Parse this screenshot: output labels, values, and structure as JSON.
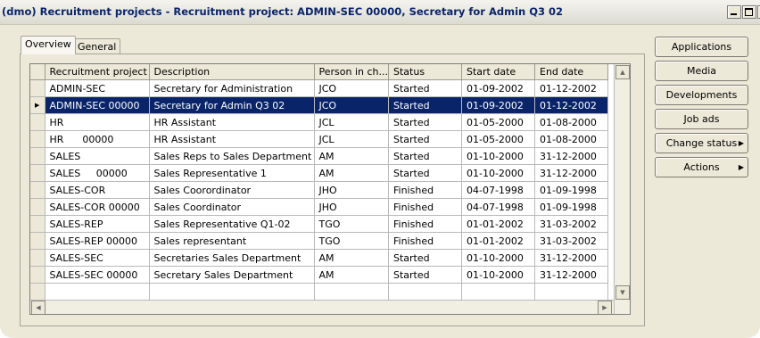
{
  "window": {
    "title": "(dmo) Recruitment projects - Recruitment project: ADMIN-SEC 00000, Secretary for Admin Q3 02"
  },
  "tabs": [
    {
      "label": "Overview",
      "active": true
    },
    {
      "label": "General",
      "active": false
    }
  ],
  "grid": {
    "columns": [
      "Recruitment project",
      "Description",
      "Person in ch...",
      "Status",
      "Start date",
      "End date"
    ],
    "selected_row": 1,
    "rows": [
      [
        "ADMIN-SEC",
        "Secretary for Administration",
        "JCO",
        "Started",
        "01-09-2002",
        "01-12-2002"
      ],
      [
        "ADMIN-SEC 00000",
        "Secretary for Admin Q3 02",
        "JCO",
        "Started",
        "01-09-2002",
        "01-12-2002"
      ],
      [
        "HR",
        "HR Assistant",
        "JCL",
        "Started",
        "01-05-2000",
        "01-08-2000"
      ],
      [
        "HR      00000",
        "HR Assistant",
        "JCL",
        "Started",
        "01-05-2000",
        "01-08-2000"
      ],
      [
        "SALES",
        "Sales Reps to Sales Department",
        "AM",
        "Started",
        "01-10-2000",
        "31-12-2000"
      ],
      [
        "SALES     00000",
        "Sales Representative 1",
        "AM",
        "Started",
        "01-10-2000",
        "31-12-2000"
      ],
      [
        "SALES-COR",
        "Sales Coorordinator",
        "JHO",
        "Finished",
        "04-07-1998",
        "01-09-1998"
      ],
      [
        "SALES-COR 00000",
        "Sales Coordinator",
        "JHO",
        "Finished",
        "04-07-1998",
        "01-09-1998"
      ],
      [
        "SALES-REP",
        "Sales Representative Q1-02",
        "TGO",
        "Finished",
        "01-01-2002",
        "31-03-2002"
      ],
      [
        "SALES-REP 00000",
        "Sales representant",
        "TGO",
        "Finished",
        "01-01-2002",
        "31-03-2002"
      ],
      [
        "SALES-SEC",
        "Secretaries Sales Department",
        "AM",
        "Started",
        "01-10-2000",
        "31-12-2000"
      ],
      [
        "SALES-SEC 00000",
        "Secretary Sales Department",
        "AM",
        "Started",
        "01-10-2000",
        "31-12-2000"
      ]
    ]
  },
  "side_buttons": [
    {
      "label": "Applications",
      "has_arrow": false
    },
    {
      "label": "Media",
      "has_arrow": false
    },
    {
      "label": "Developments",
      "has_arrow": false
    },
    {
      "label": "Job ads",
      "has_arrow": false
    },
    {
      "label": "Change status",
      "has_arrow": true
    },
    {
      "label": "Actions",
      "has_arrow": true
    }
  ],
  "colors": {
    "selection": "#0a246a",
    "title_text": "#0a246a",
    "window_bg": "#ece9d8"
  }
}
